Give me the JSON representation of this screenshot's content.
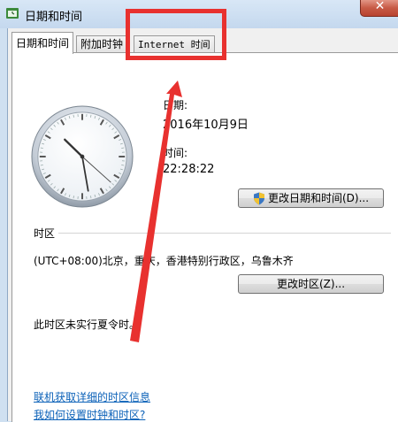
{
  "window": {
    "title": "日期和时间",
    "close_glyph": "✕"
  },
  "tabs": [
    {
      "label": "日期和时间",
      "active": true
    },
    {
      "label": "附加时钟",
      "active": false
    },
    {
      "label": "Internet 时间",
      "active": false
    }
  ],
  "date": {
    "label": "日期:",
    "value": "2016年10月9日"
  },
  "time": {
    "label": "时间:",
    "value": "22:28:22"
  },
  "clock": {
    "hour": 22,
    "minute": 28,
    "second": 22
  },
  "buttons": {
    "change_datetime": "更改日期和时间(D)...",
    "change_timezone": "更改时区(Z)..."
  },
  "timezone": {
    "section_label": "时区",
    "value": "(UTC+08:00)北京，重庆，香港特别行政区，乌鲁木齐",
    "dst_note": "此时区未实行夏令时。"
  },
  "links": {
    "tz_info": "联机获取详细的时区信息",
    "howto": "我如何设置时钟和时区?"
  },
  "annotation_color": "#e8312f",
  "accent_link_color": "#0b61b8"
}
